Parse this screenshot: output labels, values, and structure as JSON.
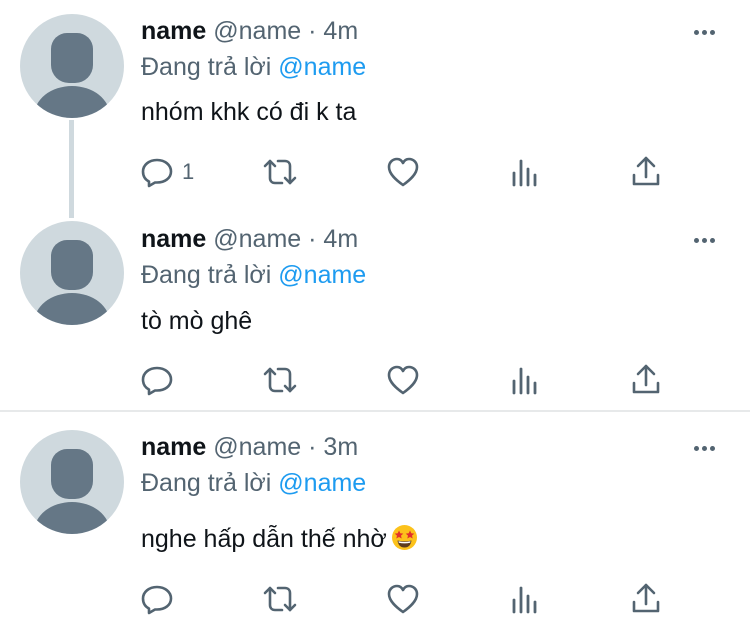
{
  "tweets": [
    {
      "name": "name",
      "handle": "@name",
      "separator": "·",
      "time": "4m",
      "reply_prefix": "Đang trả lời",
      "reply_to": "@name",
      "text": "nhóm khk có đi k ta",
      "reply_count": "1"
    },
    {
      "name": "name",
      "handle": "@name",
      "separator": "·",
      "time": "4m",
      "reply_prefix": "Đang trả lời",
      "reply_to": "@name",
      "text": "tò mò ghê",
      "reply_count": ""
    },
    {
      "name": "name",
      "handle": "@name",
      "separator": "·",
      "time": "3m",
      "reply_prefix": "Đang trả lời",
      "reply_to": "@name",
      "text": "nghe hấp dẫn thế nhờ",
      "reply_count": ""
    }
  ],
  "icons": {
    "reply": "reply-icon",
    "retweet": "retweet-icon",
    "like": "heart-icon",
    "analytics": "analytics-icon",
    "share": "share-icon",
    "more": "more-icon",
    "emoji": "star-struck-emoji"
  },
  "colors": {
    "text": "#0f1419",
    "secondary": "#536471",
    "mention": "#1d9bf0",
    "avatar_bg": "#cfd9de",
    "avatar_fg": "#657786",
    "divider": "#e7e9ea"
  }
}
